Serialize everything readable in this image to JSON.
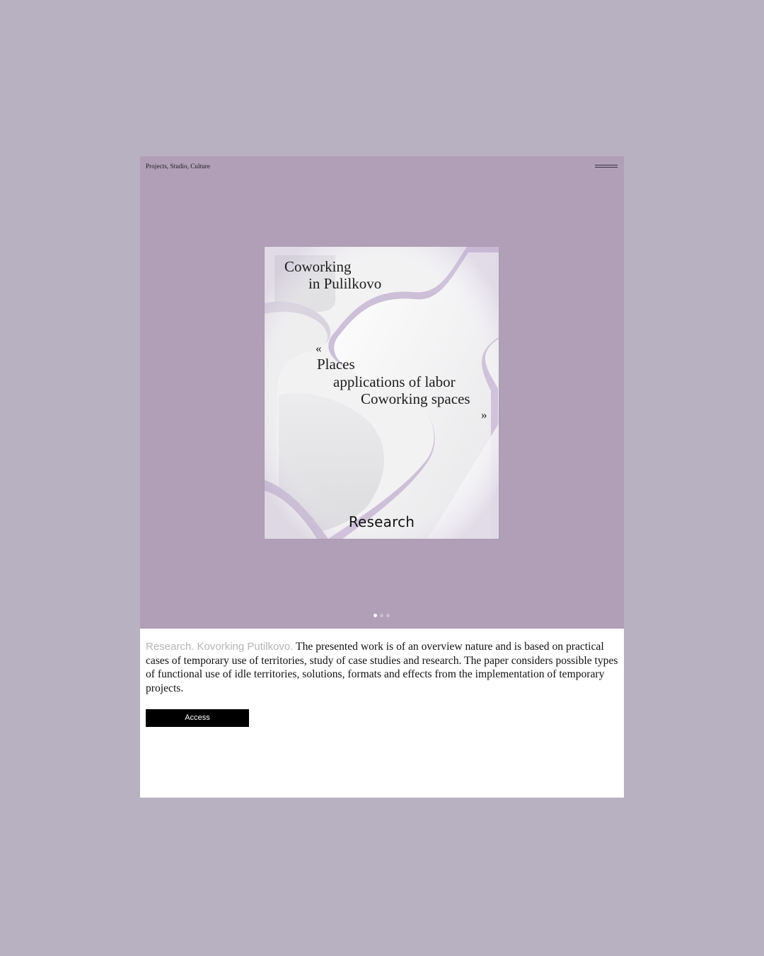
{
  "header": {
    "title": "Projects, Studio, Culture",
    "menu_icon": "hamburger-menu-icon"
  },
  "cover": {
    "title_line1": "Coworking",
    "title_line2": "in Pulilkovo",
    "quote_open": "«",
    "quote_line1": "Places",
    "quote_line2": "applications of labor",
    "quote_line3": "Coworking spaces",
    "quote_close": "»",
    "label": "Research"
  },
  "carousel": {
    "total_slides": 3,
    "active_index": 0
  },
  "description": {
    "lead": "Research. Kovorking Putilkovo.",
    "body": " The presented work is of an overview nature and is based on practical cases of temporary use of territories, study of case studies and research. The paper considers possible types of functional use of idle territories, solutions, formats and effects from the implementation of temporary projects."
  },
  "actions": {
    "access_label": "Access"
  },
  "colors": {
    "page_background": "#b8b1c1",
    "hero_background": "#b09fb6",
    "panel_background": "#ffffff",
    "button_background": "#000000",
    "lead_text": "#b5b5b8"
  }
}
